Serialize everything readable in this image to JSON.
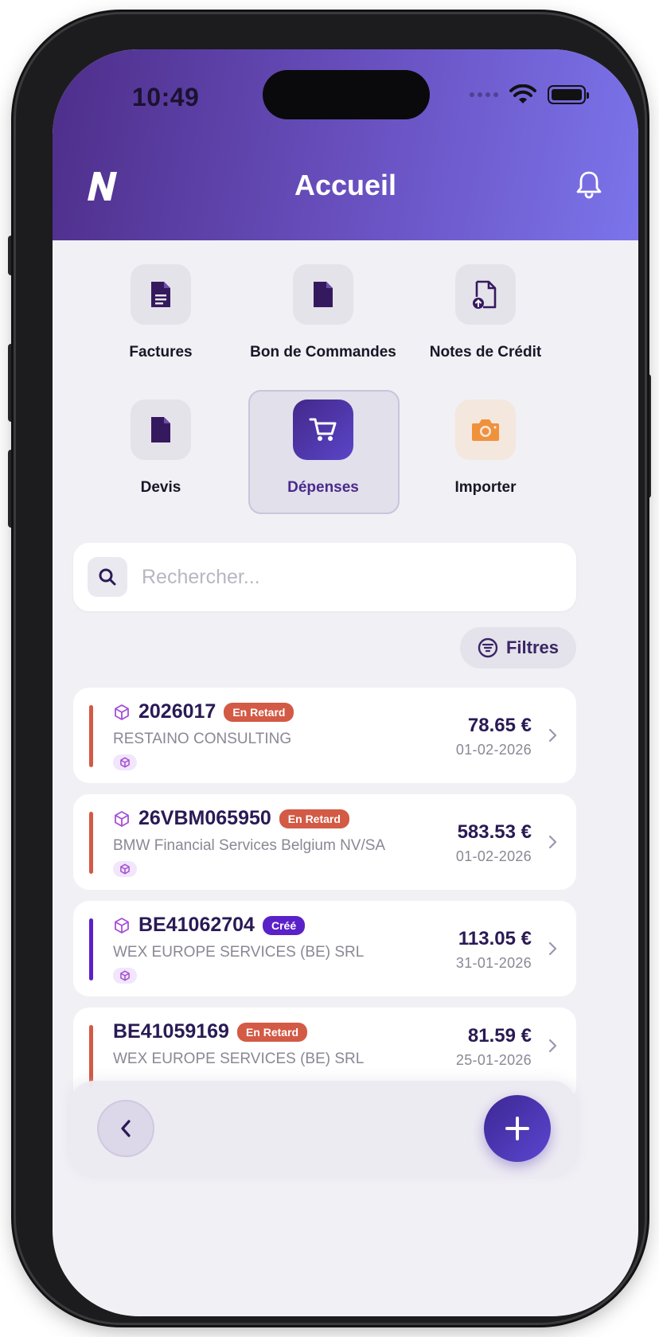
{
  "status_bar": {
    "time": "10:49",
    "icons": [
      "signal-dots-icon",
      "wifi-icon",
      "battery-icon"
    ]
  },
  "header": {
    "title": "Accueil",
    "logo_icon": "n-logo-icon",
    "notification_icon": "bell-icon"
  },
  "categories": [
    {
      "label": "Factures",
      "icon": "document-lines-icon",
      "active": false
    },
    {
      "label": "Bon de Commandes",
      "icon": "document-icon",
      "active": false
    },
    {
      "label": "Notes de Crédit",
      "icon": "document-upload-icon",
      "active": false
    },
    {
      "label": "Devis",
      "icon": "document-icon",
      "active": false
    },
    {
      "label": "Dépenses",
      "icon": "shopping-cart-icon",
      "active": true
    },
    {
      "label": "Importer",
      "icon": "camera-icon",
      "active": false
    }
  ],
  "search": {
    "placeholder": "Rechercher...",
    "value": ""
  },
  "filters": {
    "label": "Filtres"
  },
  "expenses": [
    {
      "reference": "2026017",
      "status": "En Retard",
      "company": "RESTAINO CONSULTING",
      "amount": "78.65 €",
      "date": "01-02-2026",
      "has_icon": true
    },
    {
      "reference": "26VBM065950",
      "status": "En Retard",
      "company": "BMW Financial Services Belgium NV/SA",
      "amount": "583.53 €",
      "date": "01-02-2026",
      "has_icon": true
    },
    {
      "reference": "BE41062704",
      "status": "Créé",
      "company": "WEX EUROPE SERVICES (BE) SRL",
      "amount": "113.05 €",
      "date": "31-01-2026",
      "has_icon": true
    },
    {
      "reference": "BE41059169",
      "status": "En Retard",
      "company": "WEX EUROPE SERVICES (BE) SRL",
      "amount": "81.59 €",
      "date": "25-01-2026",
      "has_icon": false
    }
  ],
  "colors": {
    "header_gradient_start": "#4e2e8a",
    "header_gradient_end": "#7b74ea",
    "late": "#d35a45",
    "created": "#5b21c9",
    "primary_text": "#2a1a55",
    "importer_accent": "#f0913c"
  },
  "bottom_bar": {
    "back_icon": "chevron-left-icon",
    "add_icon": "plus-icon"
  }
}
